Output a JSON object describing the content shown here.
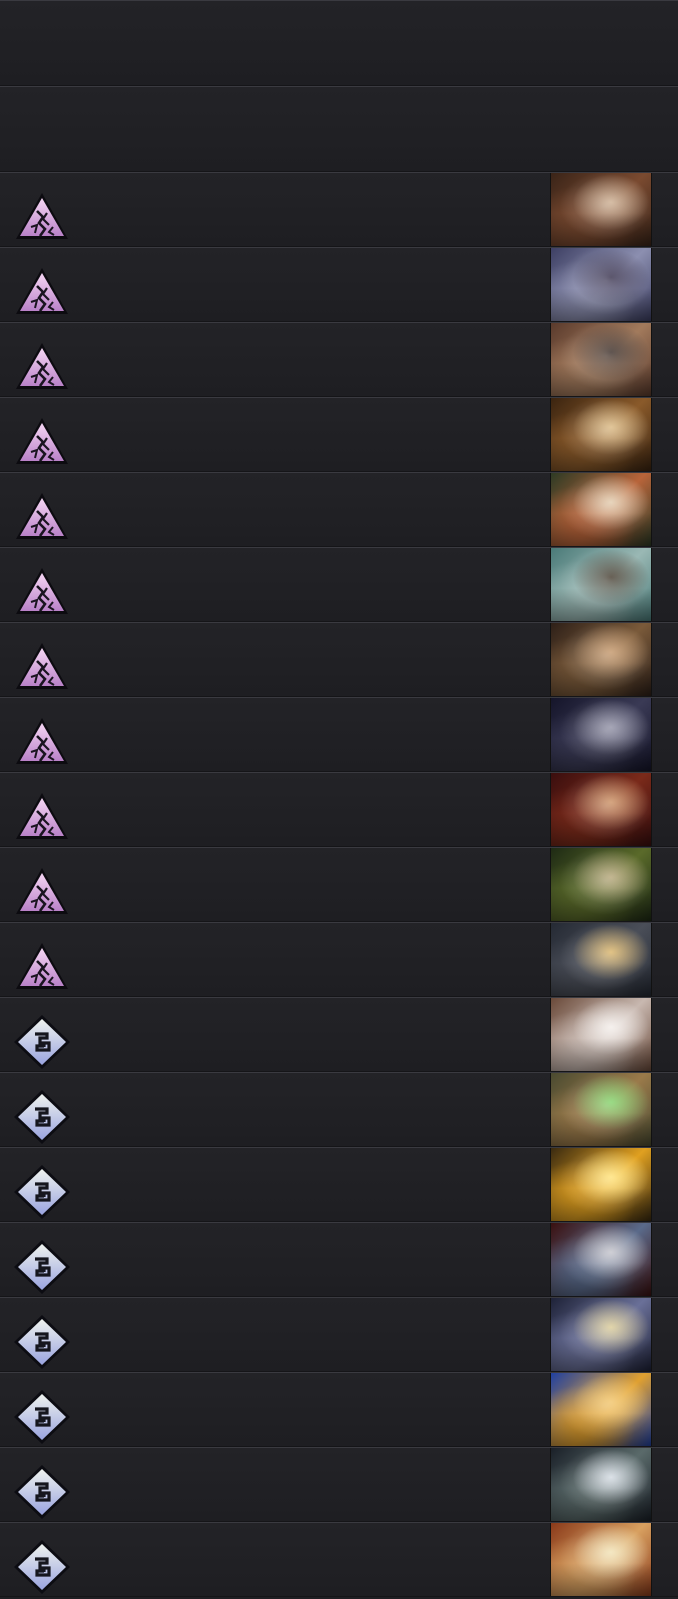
{
  "header_rows": 2,
  "cards": [
    {
      "faction": "pyramid-faction-icon",
      "art": [
        "#3a2418",
        "#7a4a30",
        "#c9a98a"
      ]
    },
    {
      "faction": "pyramid-faction-icon",
      "art": [
        "#3d3f63",
        "#8c8fb0",
        "#2a2340"
      ]
    },
    {
      "faction": "pyramid-faction-icon",
      "art": [
        "#5a3a2c",
        "#a27a5c",
        "#2f211b"
      ]
    },
    {
      "faction": "pyramid-faction-icon",
      "art": [
        "#3b2410",
        "#8a5a2a",
        "#d8b47a"
      ]
    },
    {
      "faction": "pyramid-faction-icon",
      "art": [
        "#2d3a24",
        "#b8643a",
        "#e0c8a8"
      ]
    },
    {
      "faction": "pyramid-faction-icon",
      "art": [
        "#4a7a78",
        "#9ab8b4",
        "#3a3022"
      ]
    },
    {
      "faction": "pyramid-faction-icon",
      "art": [
        "#2e2018",
        "#7a5a3a",
        "#c09060"
      ]
    },
    {
      "faction": "pyramid-faction-icon",
      "art": [
        "#15152a",
        "#3a3a55",
        "#8a8aa0"
      ]
    },
    {
      "faction": "pyramid-faction-icon",
      "art": [
        "#3a0e0e",
        "#7a2a1a",
        "#c88a5a"
      ]
    },
    {
      "faction": "pyramid-faction-icon",
      "art": [
        "#1e2a14",
        "#5a6a2a",
        "#b0a070"
      ]
    },
    {
      "faction": "pyramid-faction-icon",
      "art": [
        "#252a34",
        "#4a4e58",
        "#d8b060"
      ]
    },
    {
      "faction": "diamond-faction-icon",
      "art": [
        "#6a4a3a",
        "#c8b8b0",
        "#f2ece8"
      ]
    },
    {
      "faction": "diamond-faction-icon",
      "art": [
        "#4a4a30",
        "#9a7a4a",
        "#7ad060"
      ]
    },
    {
      "faction": "diamond-faction-icon",
      "art": [
        "#3a2a10",
        "#e0a020",
        "#ffe070"
      ]
    },
    {
      "faction": "diamond-faction-icon",
      "art": [
        "#3a1010",
        "#5a6a8a",
        "#c0c0c8"
      ]
    },
    {
      "faction": "diamond-faction-icon",
      "art": [
        "#1e2238",
        "#6a7098",
        "#d8c890"
      ]
    },
    {
      "faction": "diamond-faction-icon",
      "art": [
        "#2040a0",
        "#e0a030",
        "#f0c060"
      ]
    },
    {
      "faction": "diamond-faction-icon",
      "art": [
        "#1a2028",
        "#5a6a6a",
        "#d0d8e0"
      ]
    },
    {
      "faction": "diamond-faction-icon",
      "art": [
        "#8a3a1a",
        "#d8a060",
        "#f0e0b0"
      ]
    }
  ]
}
